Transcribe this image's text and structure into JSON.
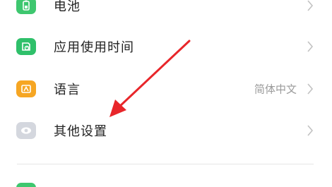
{
  "settings": {
    "items": [
      {
        "label": "电池",
        "value": "",
        "icon": "battery-icon",
        "icon_color": "#3ec76f"
      },
      {
        "label": "应用使用时间",
        "value": "",
        "icon": "app-usage-icon",
        "icon_color": "#2fc06a"
      },
      {
        "label": "语言",
        "value": "简体中文",
        "icon": "language-icon",
        "icon_color": "#f6a623"
      },
      {
        "label": "其他设置",
        "value": "",
        "icon": "other-settings-icon",
        "icon_color": "#d4d7de"
      }
    ],
    "next_item_icon_color": "#3ec76f"
  },
  "annotation": {
    "arrow_color": "#e8262a"
  }
}
